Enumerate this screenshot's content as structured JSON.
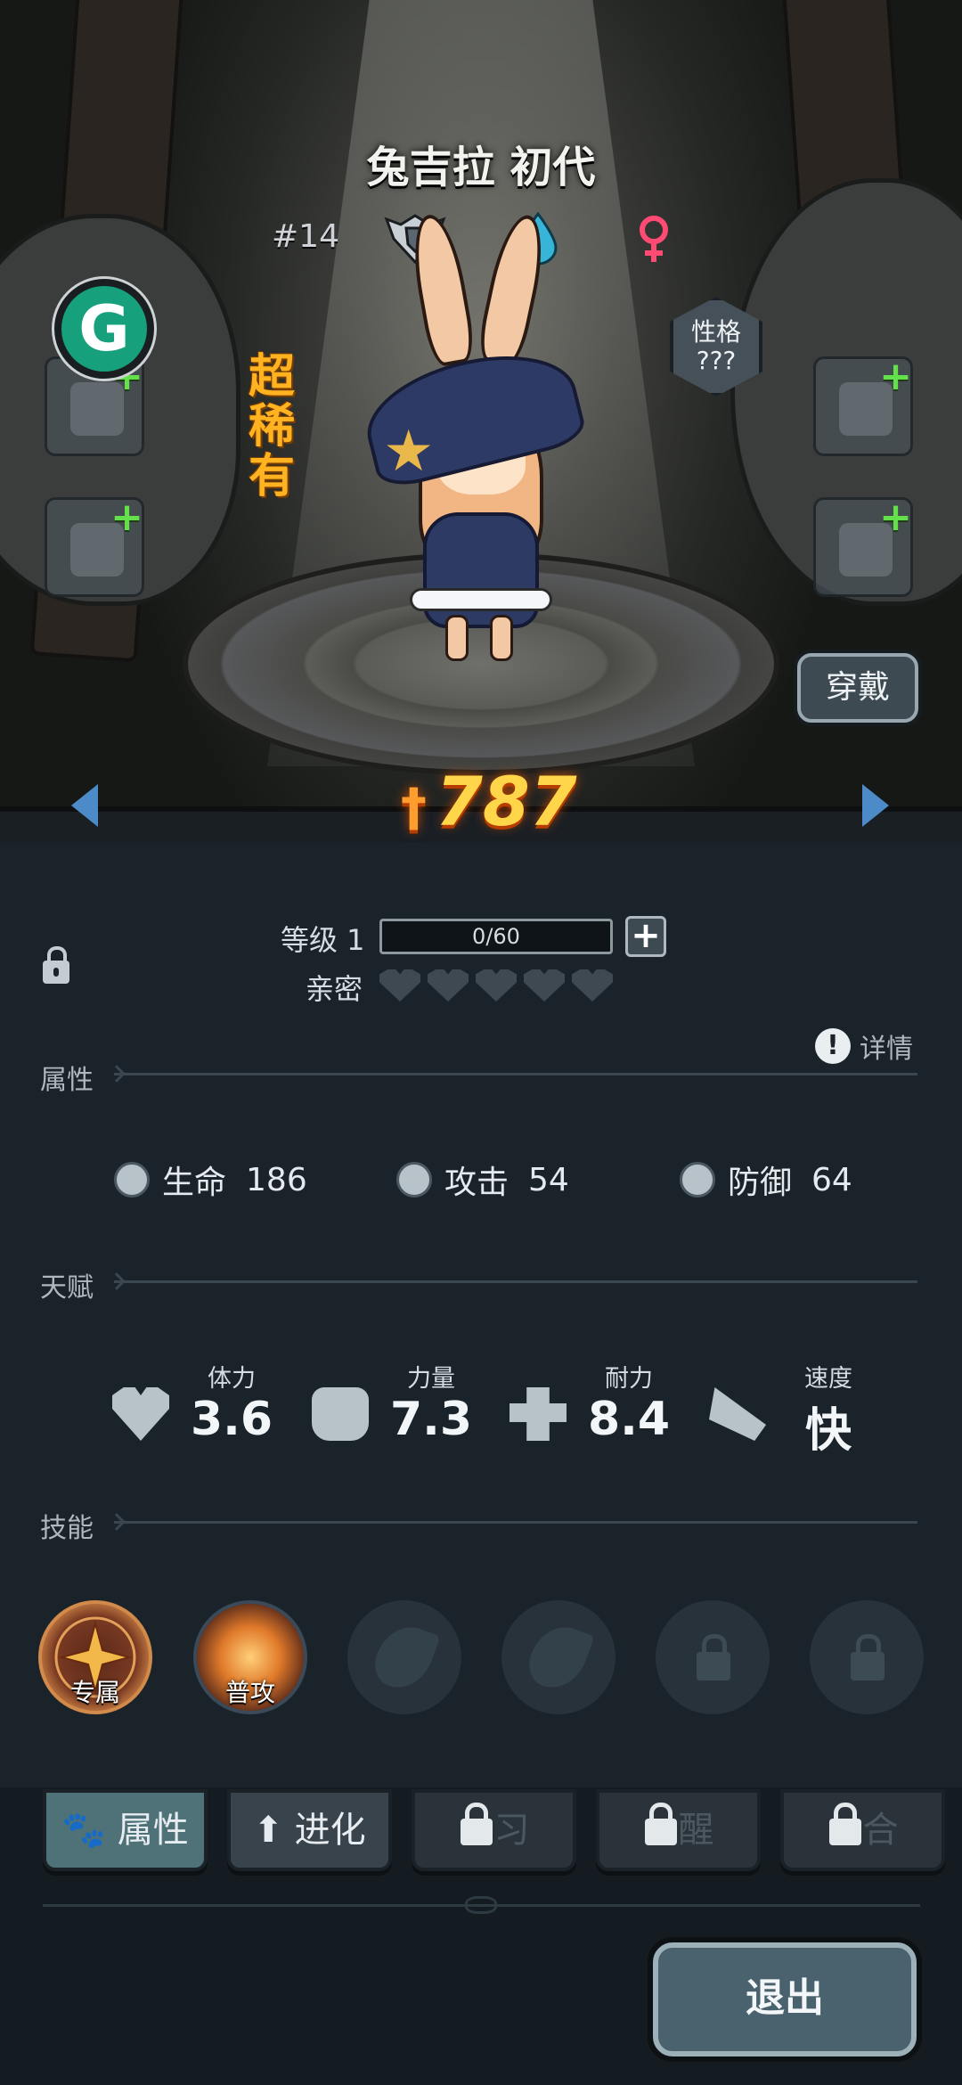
{
  "character": {
    "name": "兔吉拉 初代",
    "number": "#14",
    "rarity": "超稀有",
    "personality_label": "性格",
    "personality_value": "???",
    "power": "787"
  },
  "scene": {
    "wear_button": "穿戴"
  },
  "progress": {
    "level_label": "等级 1",
    "level_progress_text": "0/60",
    "level_progress_fraction": 0,
    "intimacy_label": "亲密",
    "intimacy_hearts_filled": 0,
    "intimacy_hearts_total": 5
  },
  "detail_link": "详情",
  "sections": {
    "attributes": "属性",
    "talent": "天赋",
    "skills": "技能"
  },
  "stats": [
    {
      "label": "生命",
      "value": "186",
      "icon": "health-icon"
    },
    {
      "label": "攻击",
      "value": "54",
      "icon": "attack-icon"
    },
    {
      "label": "防御",
      "value": "64",
      "icon": "defense-icon"
    }
  ],
  "talents": [
    {
      "label": "体力",
      "value": "3.6",
      "icon": "heart-icon"
    },
    {
      "label": "力量",
      "value": "7.3",
      "icon": "fist-icon"
    },
    {
      "label": "耐力",
      "value": "8.4",
      "icon": "muscle-icon"
    },
    {
      "label": "速度",
      "value": "快",
      "icon": "wing-icon"
    }
  ],
  "skills": [
    {
      "label": "专属",
      "state": "exclusive"
    },
    {
      "label": "普攻",
      "state": "basic"
    },
    {
      "label": "",
      "state": "empty"
    },
    {
      "label": "",
      "state": "empty"
    },
    {
      "label": "",
      "state": "locked"
    },
    {
      "label": "",
      "state": "locked"
    }
  ],
  "tabs": [
    {
      "label": "属性",
      "state": "active"
    },
    {
      "label": "进化",
      "state": "normal"
    },
    {
      "label": "习",
      "state": "locked"
    },
    {
      "label": "醒",
      "state": "locked"
    },
    {
      "label": "合",
      "state": "locked"
    }
  ],
  "exit_button": "退出",
  "colors": {
    "rarity": "#ffb321",
    "power": "#ffd64a",
    "accent_green": "#63e04a",
    "nav_arrow": "#4c8bc7",
    "panel_bg": "#1b232a"
  }
}
